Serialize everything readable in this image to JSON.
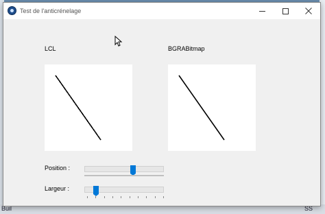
{
  "window": {
    "title": "Test de l'anticrénelage",
    "buttons": {
      "minimize": "minimize",
      "maximize": "maximize",
      "close": "close"
    }
  },
  "panels": {
    "lcl_label": "LCL",
    "bgra_label": "BGRABitmap"
  },
  "controls": {
    "position_label": "Position :",
    "position_value": 0.62,
    "largeur_label": "Largeur :",
    "largeur_value": 0.12
  },
  "background": {
    "left_text_1": "\\",
    "right_text": "SS",
    "bottom_text": "Buil"
  },
  "colors": {
    "accent": "#0078d7",
    "window_bg": "#f0f0f0"
  }
}
